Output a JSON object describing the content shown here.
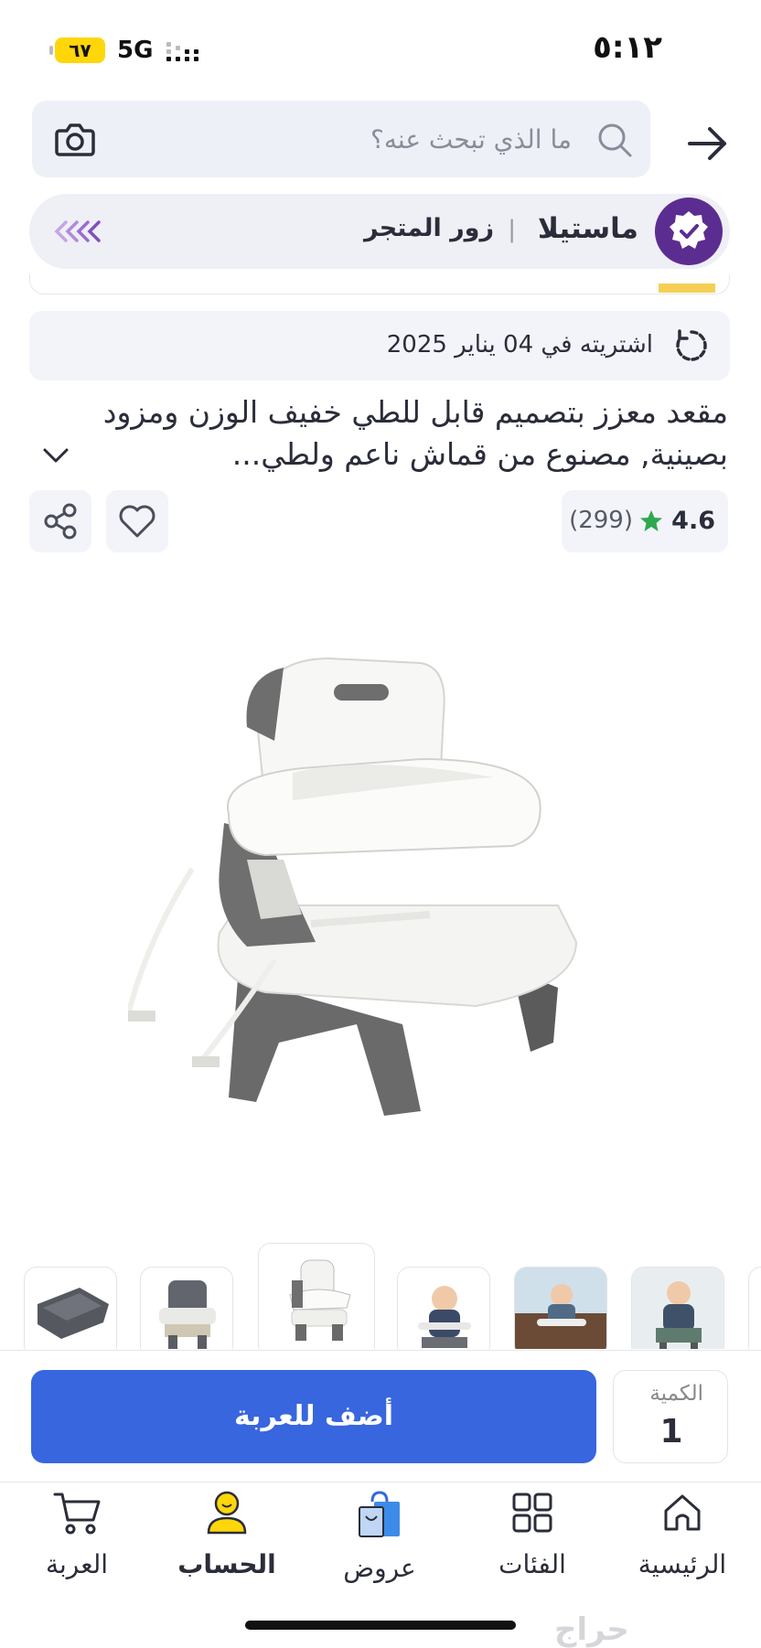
{
  "status_bar": {
    "time": "٥:١٢",
    "battery": "٦٧",
    "network": "5G"
  },
  "search": {
    "placeholder": "ما الذي تبحث عنه؟"
  },
  "store": {
    "name": "ماستيلا",
    "visit_label": "زور المتجر",
    "separator": "|"
  },
  "purchase_info": {
    "text": "اشتريته في 04 يناير 2025"
  },
  "product": {
    "title": "مقعد معزز بتصميم قابل للطي خفيف الوزن ومزود بصينية, مصنوع من قماش ناعم ولطي...",
    "rating": "4.6",
    "reviews_count": "(299)"
  },
  "thumbnails": {
    "count": 7,
    "active_index": 2
  },
  "cart": {
    "quantity_label": "الكمية",
    "quantity": "1",
    "add_label": "أضف للعربة"
  },
  "bottom_nav": {
    "items": [
      {
        "label": "الرئيسية",
        "icon": "home-icon"
      },
      {
        "label": "الفئات",
        "icon": "categories-icon"
      },
      {
        "label": "عروض",
        "icon": "offers-bag-icon"
      },
      {
        "label": "الحساب",
        "icon": "account-icon",
        "active": true
      },
      {
        "label": "العربة",
        "icon": "cart-icon"
      }
    ]
  },
  "watermark": "حراج",
  "colors": {
    "primary": "#3866df",
    "store_badge": "#5c2d91",
    "star": "#2fa84f",
    "accent_yellow": "#ffd60a"
  }
}
